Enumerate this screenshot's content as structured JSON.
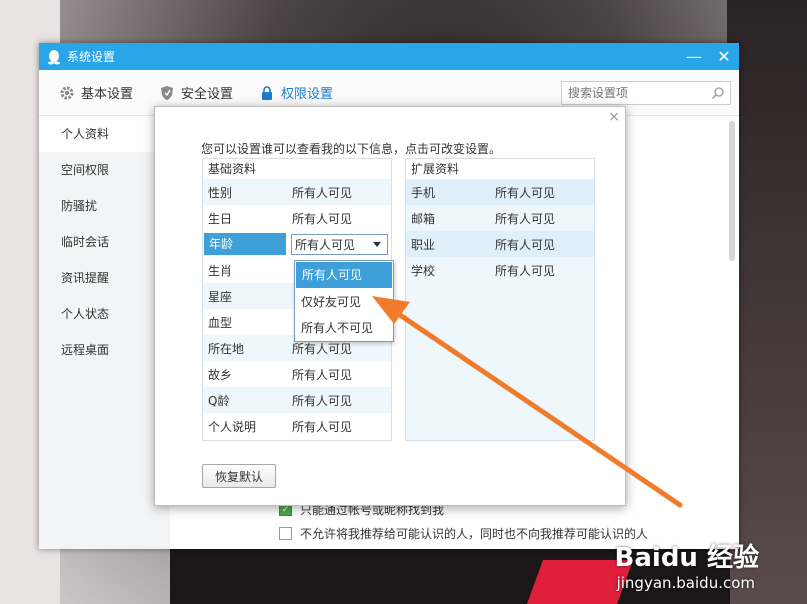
{
  "window": {
    "title": "系统设置",
    "minimize_glyph": "—",
    "close_glyph": "✕"
  },
  "toolbar": {
    "tabs": [
      {
        "label": "基本设置",
        "icon": "gear-icon"
      },
      {
        "label": "安全设置",
        "icon": "shield-icon"
      },
      {
        "label": "权限设置",
        "icon": "lock-icon"
      }
    ],
    "active_tab": "权限设置",
    "search_placeholder": "搜索设置项"
  },
  "sidebar": {
    "items": [
      {
        "label": "个人资料"
      },
      {
        "label": "空间权限"
      },
      {
        "label": "防骚扰"
      },
      {
        "label": "临时会话"
      },
      {
        "label": "资讯提醒"
      },
      {
        "label": "个人状态"
      },
      {
        "label": "远程桌面"
      }
    ]
  },
  "main": {
    "option1": "只能通过帐号或昵称找到我",
    "option2": "不允许将我推荐给可能认识的人，同时也不向我推荐可能认识的人"
  },
  "dialog": {
    "close_glyph": "×",
    "description": "您可以设置谁可以查看我的以下信息，点击可改变设置。",
    "basic": {
      "title": "基础资料",
      "rows": [
        {
          "label": "性别",
          "value": "所有人可见"
        },
        {
          "label": "生日",
          "value": "所有人可见"
        },
        {
          "label": "年龄",
          "value": "所有人可见"
        },
        {
          "label": "生肖",
          "value": ""
        },
        {
          "label": "星座",
          "value": ""
        },
        {
          "label": "血型",
          "value": ""
        },
        {
          "label": "所在地",
          "value": "所有人可见"
        },
        {
          "label": "故乡",
          "value": "所有人可见"
        },
        {
          "label": "Q龄",
          "value": "所有人可见"
        },
        {
          "label": "个人说明",
          "value": "所有人可见"
        }
      ]
    },
    "extended": {
      "title": "扩展资料",
      "rows": [
        {
          "label": "手机",
          "value": "所有人可见"
        },
        {
          "label": "邮箱",
          "value": "所有人可见"
        },
        {
          "label": "职业",
          "value": "所有人可见"
        },
        {
          "label": "学校",
          "value": "所有人可见"
        }
      ]
    },
    "dropdown_options": [
      "所有人可见",
      "仅好友可见",
      "所有人不可见"
    ],
    "restore_button": "恢复默认"
  },
  "watermark": {
    "brand": "Baidu 经验",
    "url": "jingyan.baidu.com"
  },
  "colors": {
    "titlebar": "#29a5ea",
    "selection": "#3da0d8",
    "arrow": "#f07b2a"
  }
}
